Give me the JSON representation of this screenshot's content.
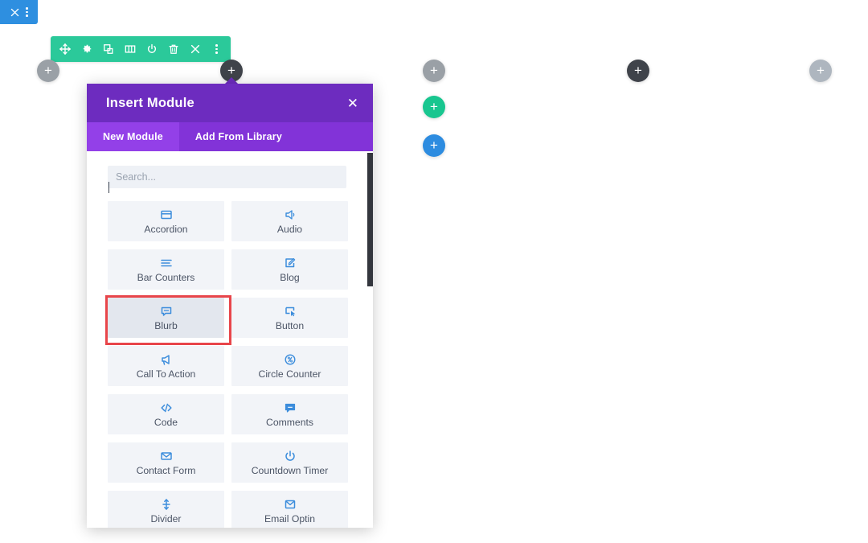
{
  "page_bar": {
    "close_label": "✕",
    "menu_icon": "vertical-ellipsis-icon"
  },
  "row_toolbar": {
    "icons": [
      {
        "name": "move-icon",
        "glyph": "move"
      },
      {
        "name": "gear-icon",
        "glyph": "gear"
      },
      {
        "name": "duplicate-icon",
        "glyph": "duplicate"
      },
      {
        "name": "columns-icon",
        "glyph": "columns"
      },
      {
        "name": "power-icon",
        "glyph": "power"
      },
      {
        "name": "trash-icon",
        "glyph": "trash"
      },
      {
        "name": "close-icon",
        "glyph": "close"
      },
      {
        "name": "more-icon",
        "glyph": "dots"
      }
    ]
  },
  "add_buttons": [
    {
      "name": "add-row-button-left",
      "color": "#9aa0a6",
      "label": "+"
    },
    {
      "name": "add-module-button-dark",
      "color": "#3f434a",
      "label": "+"
    },
    {
      "name": "add-row-button-mid",
      "color": "#9aa0a6",
      "label": "+"
    },
    {
      "name": "add-section-button-green",
      "color": "#18c68f",
      "label": "+"
    },
    {
      "name": "add-specialty-button-blue",
      "color": "#2d8ce0",
      "label": "+"
    },
    {
      "name": "add-module-button-dark-2",
      "color": "#3f434a",
      "label": "+"
    },
    {
      "name": "add-row-button-right",
      "color": "#aeb6bf",
      "label": "+"
    }
  ],
  "modal": {
    "title": "Insert Module",
    "close_label": "✕",
    "tabs": [
      {
        "label": "New Module",
        "active": true
      },
      {
        "label": "Add From Library",
        "active": false
      }
    ],
    "search": {
      "placeholder": "Search...",
      "value": ""
    },
    "modules": [
      {
        "label": "Accordion",
        "icon": "accordion-icon",
        "highlighted": false
      },
      {
        "label": "Audio",
        "icon": "audio-icon",
        "highlighted": false
      },
      {
        "label": "Bar Counters",
        "icon": "bar-counters-icon",
        "highlighted": false
      },
      {
        "label": "Blog",
        "icon": "blog-icon",
        "highlighted": false
      },
      {
        "label": "Blurb",
        "icon": "blurb-icon",
        "highlighted": true
      },
      {
        "label": "Button",
        "icon": "button-icon",
        "highlighted": false
      },
      {
        "label": "Call To Action",
        "icon": "call-to-action-icon",
        "highlighted": false
      },
      {
        "label": "Circle Counter",
        "icon": "circle-counter-icon",
        "highlighted": false
      },
      {
        "label": "Code",
        "icon": "code-icon",
        "highlighted": false
      },
      {
        "label": "Comments",
        "icon": "comments-icon",
        "highlighted": false
      },
      {
        "label": "Contact Form",
        "icon": "contact-form-icon",
        "highlighted": false
      },
      {
        "label": "Countdown Timer",
        "icon": "countdown-timer-icon",
        "highlighted": false
      },
      {
        "label": "Divider",
        "icon": "divider-icon",
        "highlighted": false
      },
      {
        "label": "Email Optin",
        "icon": "email-optin-icon",
        "highlighted": false
      }
    ]
  },
  "colors": {
    "header_purple": "#6d2cbf",
    "tab_purple": "#8233d8",
    "tab_active_purple": "#9340e8",
    "toolbar_green": "#2bc99a",
    "page_bar_blue": "#2e8fe0",
    "highlight_red": "#e8454a",
    "icon_blue": "#3c8ddc",
    "tile_bg": "#f2f4f8"
  }
}
